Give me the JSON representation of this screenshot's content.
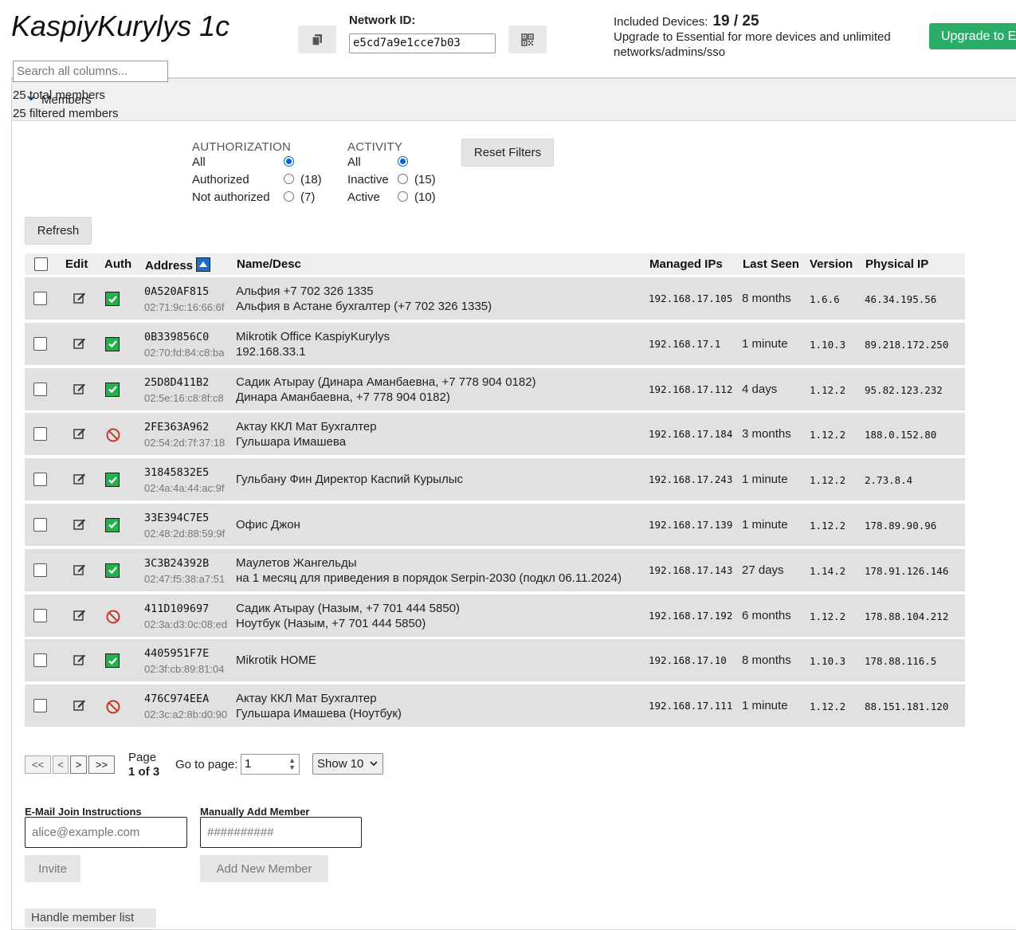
{
  "header": {
    "network_name": "KaspiyKurylys 1c",
    "network_id_label": "Network ID:",
    "network_id": "e5cd7a9e1cce7b03",
    "included_devices_label": "Included Devices:",
    "included_devices_count": "19 / 25",
    "upgrade_message": "Upgrade to Essential for more devices and unlimited networks/admins/sso",
    "upgrade_button": "Upgrade to Essential",
    "copy_icon": "copy-icon",
    "qr_icon": "qr-code-icon",
    "colors": {
      "upgrade": "#2bad6a",
      "auth_ok": "#23b14d",
      "sort": "#1e6fc2"
    }
  },
  "members": {
    "section_title": "Members",
    "search_placeholder": "Search all columns...",
    "total_members": "25 total members",
    "filtered_members": "25 filtered members",
    "authorization": {
      "title": "AUTHORIZATION",
      "options": [
        {
          "label": "All",
          "count": "",
          "selected": true
        },
        {
          "label": "Authorized",
          "count": "(18)",
          "selected": false
        },
        {
          "label": "Not authorized",
          "count": "(7)",
          "selected": false
        }
      ]
    },
    "activity": {
      "title": "ACTIVITY",
      "options": [
        {
          "label": "All",
          "count": "",
          "selected": true
        },
        {
          "label": "Inactive",
          "count": "(15)",
          "selected": false
        },
        {
          "label": "Active",
          "count": "(10)",
          "selected": false
        }
      ]
    },
    "reset_filters": "Reset Filters",
    "refresh": "Refresh",
    "columns": {
      "edit": "Edit",
      "auth": "Auth",
      "address": "Address",
      "name": "Name/Desc",
      "managed_ips": "Managed IPs",
      "last_seen": "Last Seen",
      "version": "Version",
      "physical_ip": "Physical IP"
    },
    "rows": [
      {
        "id": "0A520AF815",
        "mac": "02:71:9c:16:66:6f",
        "name": "Альфия +7 702 326 1335",
        "desc": "Альфия в Астане бухгалтер (+7 702 326 1335)",
        "ip": "192.168.17.105",
        "seen": "8 months",
        "version": "1.6.6",
        "phys": "46.34.195.56",
        "auth": true
      },
      {
        "id": "0B339856C0",
        "mac": "02:70:fd:84:c8:ba",
        "name": "Mikrotik Office KaspiyKurylys",
        "desc": "192.168.33.1",
        "ip": "192.168.17.1",
        "seen": "1 minute",
        "version": "1.10.3",
        "phys": "89.218.172.250",
        "auth": true
      },
      {
        "id": "25D8D411B2",
        "mac": "02:5e:16:c8:8f:c8",
        "name": "Садик Атырау (Динара Аманбаевна, +7 778 904 0182)",
        "desc": "Динара Аманбаевна, +7 778 904 0182)",
        "ip": "192.168.17.112",
        "seen": "4 days",
        "version": "1.12.2",
        "phys": "95.82.123.232",
        "auth": true
      },
      {
        "id": "2FE363A962",
        "mac": "02:54:2d:7f:37:18",
        "name": "Актау ККЛ Мат Бухгалтер",
        "desc": "Гульшара Имашева",
        "ip": "192.168.17.184",
        "seen": "3 months",
        "version": "1.12.2",
        "phys": "188.0.152.80",
        "auth": false
      },
      {
        "id": "31845832E5",
        "mac": "02:4a:4a:44:ac:9f",
        "name": "Гульбану Фин Директор Каспий Курылыс",
        "desc": "",
        "ip": "192.168.17.243",
        "seen": "1 minute",
        "version": "1.12.2",
        "phys": "2.73.8.4",
        "auth": true
      },
      {
        "id": "33E394C7E5",
        "mac": "02:48:2d:88:59:9f",
        "name": "Офис Джон",
        "desc": "",
        "ip": "192.168.17.139",
        "seen": "1 minute",
        "version": "1.12.2",
        "phys": "178.89.90.96",
        "auth": true
      },
      {
        "id": "3C3B24392B",
        "mac": "02:47:f5:38:a7:51",
        "name": "Маулетов Жангельды",
        "desc": "на 1 месяц для приведения в порядок Serpin-2030 (подкл 06.11.2024)",
        "ip": "192.168.17.143",
        "seen": "27 days",
        "version": "1.14.2",
        "phys": "178.91.126.146",
        "auth": true
      },
      {
        "id": "411D109697",
        "mac": "02:3a:d3:0c:08:ed",
        "name": "Садик Атырау (Назым, +7 701 444 5850)",
        "desc": "Ноутбук (Назым, +7 701 444 5850)",
        "ip": "192.168.17.192",
        "seen": "6 months",
        "version": "1.12.2",
        "phys": "178.88.104.212",
        "auth": false
      },
      {
        "id": "4405951F7E",
        "mac": "02:3f:cb:89:81:04",
        "name": "Mikrotik HOME",
        "desc": "",
        "ip": "192.168.17.10",
        "seen": "8 months",
        "version": "1.10.3",
        "phys": "178.88.116.5",
        "auth": true
      },
      {
        "id": "476C974EEA",
        "mac": "02:3c:a2:8b:d0:90",
        "name": "Актау ККЛ Мат Бухгалтер",
        "desc": "Гульшара Имашева (Ноутбук)",
        "ip": "192.168.17.111",
        "seen": "1 minute",
        "version": "1.12.2",
        "phys": "88.151.181.120",
        "auth": false
      }
    ],
    "pagination": {
      "first": "<<",
      "prev": "<",
      "next": ">",
      "last": ">>",
      "page_word": "Page",
      "page_of": "1 of 3",
      "goto_label": "Go to page:",
      "goto_value": "1",
      "show": "Show 10"
    },
    "email_join": {
      "label": "E-Mail Join Instructions",
      "placeholder": "alice@example.com",
      "button": "Invite"
    },
    "manual_add": {
      "label": "Manually Add Member",
      "placeholder": "##########",
      "button": "Add New Member"
    },
    "handle_button": "Handle member list"
  }
}
